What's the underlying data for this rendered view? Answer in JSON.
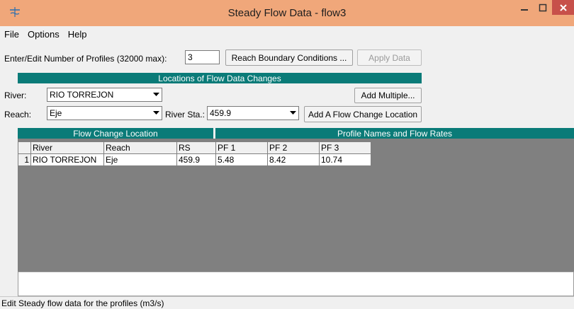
{
  "window": {
    "title": "Steady Flow Data - flow3"
  },
  "menu": [
    {
      "label": "File"
    },
    {
      "label": "Options"
    },
    {
      "label": "Help"
    }
  ],
  "profiles": {
    "label": "Enter/Edit Number of Profiles (32000 max):",
    "value": "3",
    "reach_boundary_button": "Reach Boundary Conditions ...",
    "apply_button": "Apply Data"
  },
  "locations": {
    "header": "Locations of Flow Data Changes",
    "river_label": "River:",
    "river_value": "RIO TORREJON",
    "add_multiple_button": "Add Multiple...",
    "reach_label": "Reach:",
    "reach_value": "Eje",
    "river_sta_label": "River Sta.:",
    "river_sta_value": "459.9",
    "add_location_button": "Add A Flow Change Location"
  },
  "table": {
    "flow_change_header": "Flow Change Location",
    "profile_header": "Profile Names and Flow Rates",
    "columns": [
      "River",
      "Reach",
      "RS",
      "PF 1",
      "PF 2",
      "PF 3"
    ],
    "rows": [
      {
        "num": "1",
        "cells": [
          "RIO TORREJON",
          "Eje",
          "459.9",
          "5.48",
          "8.42",
          "10.74"
        ]
      }
    ]
  },
  "status": {
    "text": "Edit Steady flow data for the profiles (m3/s)"
  },
  "colors": {
    "titlebar": "#f0a77a",
    "close": "#c7504a",
    "teal": "#0a7b78",
    "grid_bg": "#808080"
  }
}
